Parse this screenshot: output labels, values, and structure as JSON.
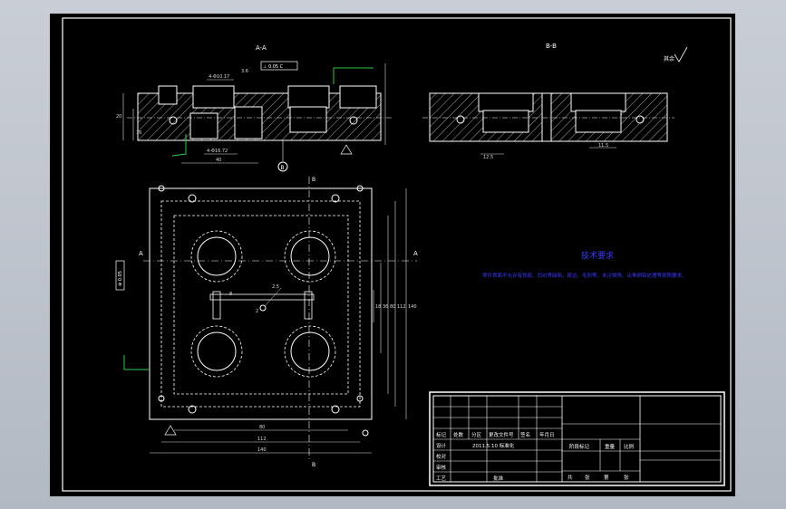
{
  "drawing": {
    "section_aa_label": "A-A",
    "section_bb_label": "B-B",
    "cut_label_a": "A",
    "cut_label_b": "B",
    "roughness_symbol": "其余",
    "datum_b": "B",
    "datum_a": "A",
    "tolerance_box": "⊥ 0.05 C",
    "position_box": "⊕ 0.05",
    "dims_aa": [
      "4-Φ10.17",
      "4-Φ16.72",
      "40",
      "20",
      "16",
      "3.6"
    ],
    "dims_bb": [
      "12.5",
      "11.5"
    ],
    "dims_plan_horizontal": [
      "80",
      "112",
      "140"
    ],
    "dims_plan_vertical": [
      "18",
      "36",
      "80",
      "112",
      "140"
    ],
    "plan_small_labels": [
      "8",
      "2.5",
      "2"
    ]
  },
  "notes": {
    "title": "技术要求",
    "body": "零件表面不允许有划痕、凹坑等缺陷，棱边、毛刺等，未注倒角、尖角倒钝处理等按照要求。"
  },
  "title_block": {
    "row_headers": [
      "标记",
      "处数",
      "分区",
      "更改文件号",
      "签名",
      "年月日"
    ],
    "designer_label": "设计",
    "designer_entry": "2011.5.10 标准化",
    "checker_label": "校对",
    "reviewer_label": "审核",
    "process_label": "工艺",
    "approve_label": "批准",
    "stage_label": "阶段标记",
    "weight_label": "重量",
    "scale_label": "比例",
    "sheet_total": "共",
    "sheet_word": "张",
    "sheet_current": "第",
    "sheet_word2": "张"
  },
  "colors": {
    "background": "#000000",
    "line": "#ffffff",
    "dimension": "#e8e8e8",
    "leader_green": "#2ecc40",
    "notes_blue": "#3333ff",
    "hatch": "#dddddd"
  }
}
